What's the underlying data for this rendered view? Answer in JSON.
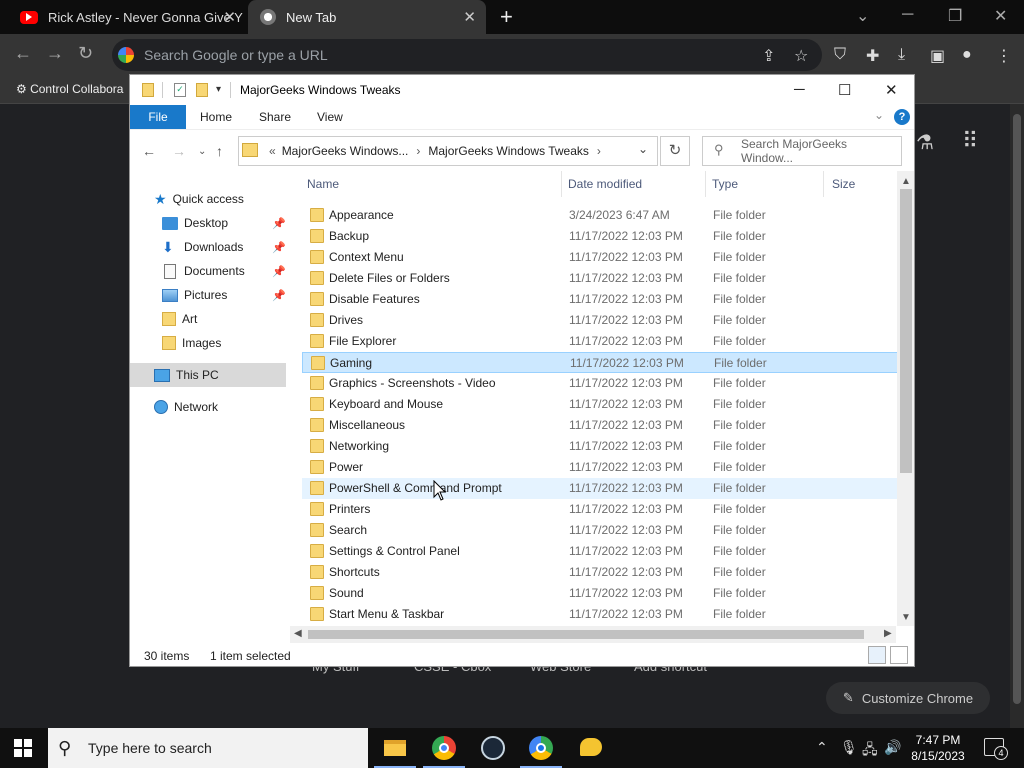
{
  "chrome": {
    "tabs": [
      {
        "title": "Rick Astley - Never Gonna Give Y",
        "close": "✕"
      },
      {
        "title": "New Tab",
        "close": "✕"
      }
    ],
    "new_tab": "+",
    "omnibox_placeholder": "Search Google or type a URL",
    "bookmark": "Control Collabora",
    "shortcuts": [
      "My Stuff",
      "CSSE - Cbox",
      "Web Store",
      "Add shortcut"
    ],
    "customize": "Customize Chrome"
  },
  "explorer": {
    "title": "MajorGeeks Windows Tweaks",
    "ribbon_tabs": [
      "File",
      "Home",
      "Share",
      "View"
    ],
    "help": "?",
    "breadcrumb": [
      "«",
      "MajorGeeks Windows...",
      "›",
      "MajorGeeks Windows Tweaks",
      "›"
    ],
    "search_placeholder": "Search MajorGeeks Window...",
    "nav": {
      "quick_access": "Quick access",
      "items": [
        "Desktop",
        "Downloads",
        "Documents",
        "Pictures",
        "Art",
        "Images"
      ],
      "this_pc": "This PC",
      "network": "Network"
    },
    "columns": [
      "Name",
      "Date modified",
      "Type",
      "Size"
    ],
    "rows": [
      {
        "name": "Appearance",
        "date": "3/24/2023 6:47 AM",
        "type": "File folder"
      },
      {
        "name": "Backup",
        "date": "11/17/2022 12:03 PM",
        "type": "File folder"
      },
      {
        "name": "Context Menu",
        "date": "11/17/2022 12:03 PM",
        "type": "File folder"
      },
      {
        "name": "Delete Files or Folders",
        "date": "11/17/2022 12:03 PM",
        "type": "File folder"
      },
      {
        "name": "Disable Features",
        "date": "11/17/2022 12:03 PM",
        "type": "File folder"
      },
      {
        "name": "Drives",
        "date": "11/17/2022 12:03 PM",
        "type": "File folder"
      },
      {
        "name": "File Explorer",
        "date": "11/17/2022 12:03 PM",
        "type": "File folder"
      },
      {
        "name": "Gaming",
        "date": "11/17/2022 12:03 PM",
        "type": "File folder"
      },
      {
        "name": "Graphics - Screenshots - Video",
        "date": "11/17/2022 12:03 PM",
        "type": "File folder"
      },
      {
        "name": "Keyboard and Mouse",
        "date": "11/17/2022 12:03 PM",
        "type": "File folder"
      },
      {
        "name": "Miscellaneous",
        "date": "11/17/2022 12:03 PM",
        "type": "File folder"
      },
      {
        "name": "Networking",
        "date": "11/17/2022 12:03 PM",
        "type": "File folder"
      },
      {
        "name": "Power",
        "date": "11/17/2022 12:03 PM",
        "type": "File folder"
      },
      {
        "name": "PowerShell & Command Prompt",
        "date": "11/17/2022 12:03 PM",
        "type": "File folder"
      },
      {
        "name": "Printers",
        "date": "11/17/2022 12:03 PM",
        "type": "File folder"
      },
      {
        "name": "Search",
        "date": "11/17/2022 12:03 PM",
        "type": "File folder"
      },
      {
        "name": "Settings & Control Panel",
        "date": "11/17/2022 12:03 PM",
        "type": "File folder"
      },
      {
        "name": "Shortcuts",
        "date": "11/17/2022 12:03 PM",
        "type": "File folder"
      },
      {
        "name": "Sound",
        "date": "11/17/2022 12:03 PM",
        "type": "File folder"
      },
      {
        "name": "Start Menu & Taskbar",
        "date": "11/17/2022 12:03 PM",
        "type": "File folder"
      }
    ],
    "selected_row": "Gaming",
    "hover_row": "PowerShell & Command Prompt",
    "status": {
      "count": "30 items",
      "selected": "1 item selected"
    }
  },
  "taskbar": {
    "search_placeholder": "Type here to search",
    "time": "7:47 PM",
    "date": "8/15/2023",
    "notifications": "4"
  }
}
